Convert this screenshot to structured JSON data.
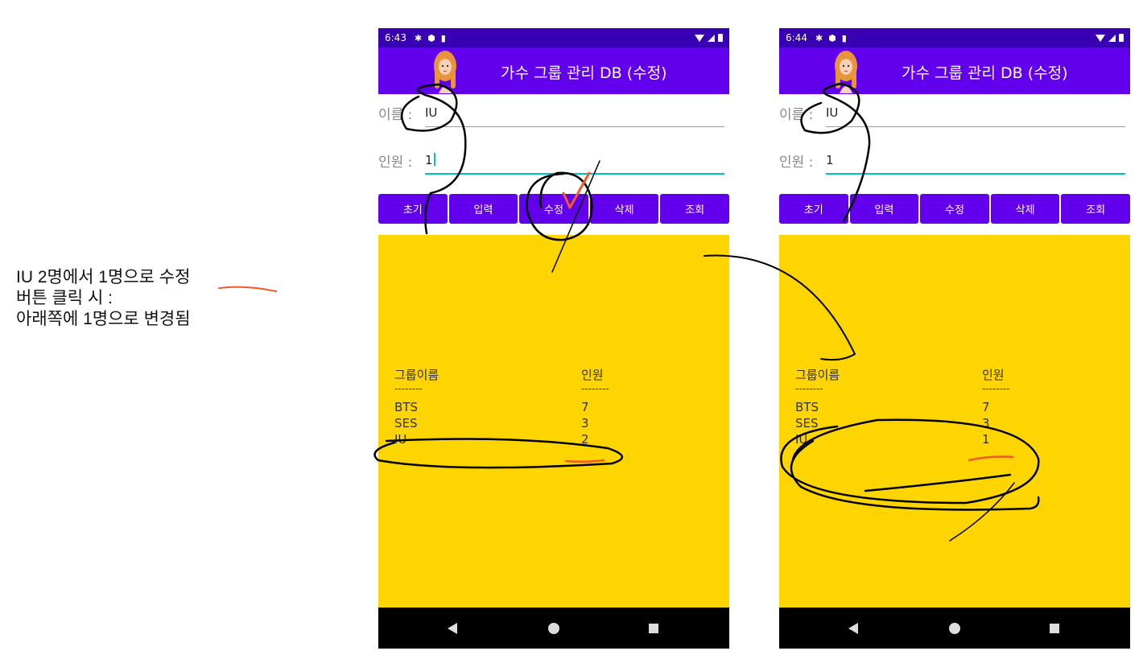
{
  "caption": {
    "line1_prefix": "IU 2명에서 1명으로 ",
    "line1_emph": "수정",
    "line2": "버튼 클릭 시 :",
    "line3": "아래쪽에 1명으로 변경됨"
  },
  "screens": [
    {
      "status_time": "6:43",
      "title": "가수 그룹 관리 DB (수정)",
      "name_label": "이름 :",
      "name_value": "IU",
      "count_label": "인원 :",
      "count_value": "1",
      "buttons": [
        "초기",
        "입력",
        "수정",
        "삭제",
        "조회"
      ],
      "table": {
        "headers": [
          "그룹이름",
          "인원"
        ],
        "separator": "--------",
        "rows": [
          [
            "BTS",
            "7"
          ],
          [
            "SES",
            "3"
          ],
          [
            "IU",
            "2"
          ]
        ]
      }
    },
    {
      "status_time": "6:44",
      "title": "가수 그룹 관리 DB (수정)",
      "name_label": "이름 :",
      "name_value": "IU",
      "count_label": "인원 :",
      "count_value": "1",
      "buttons": [
        "초기",
        "입력",
        "수정",
        "삭제",
        "조회"
      ],
      "table": {
        "headers": [
          "그룹이름",
          "인원"
        ],
        "separator": "--------",
        "rows": [
          [
            "BTS",
            "7"
          ],
          [
            "SES",
            "3"
          ],
          [
            "IU",
            "1"
          ]
        ]
      }
    }
  ],
  "colors": {
    "status_bar": "#3700b3",
    "primary": "#6200ee",
    "result_bg": "#ffd500",
    "annotation_orange": "#f05a24",
    "ink": "#000000"
  },
  "icons": [
    "gear-icon",
    "shield-icon",
    "sim-icon",
    "wifi-icon",
    "signal-icon",
    "battery-icon",
    "back-icon",
    "home-icon",
    "recents-icon",
    "girl-avatar-icon"
  ]
}
